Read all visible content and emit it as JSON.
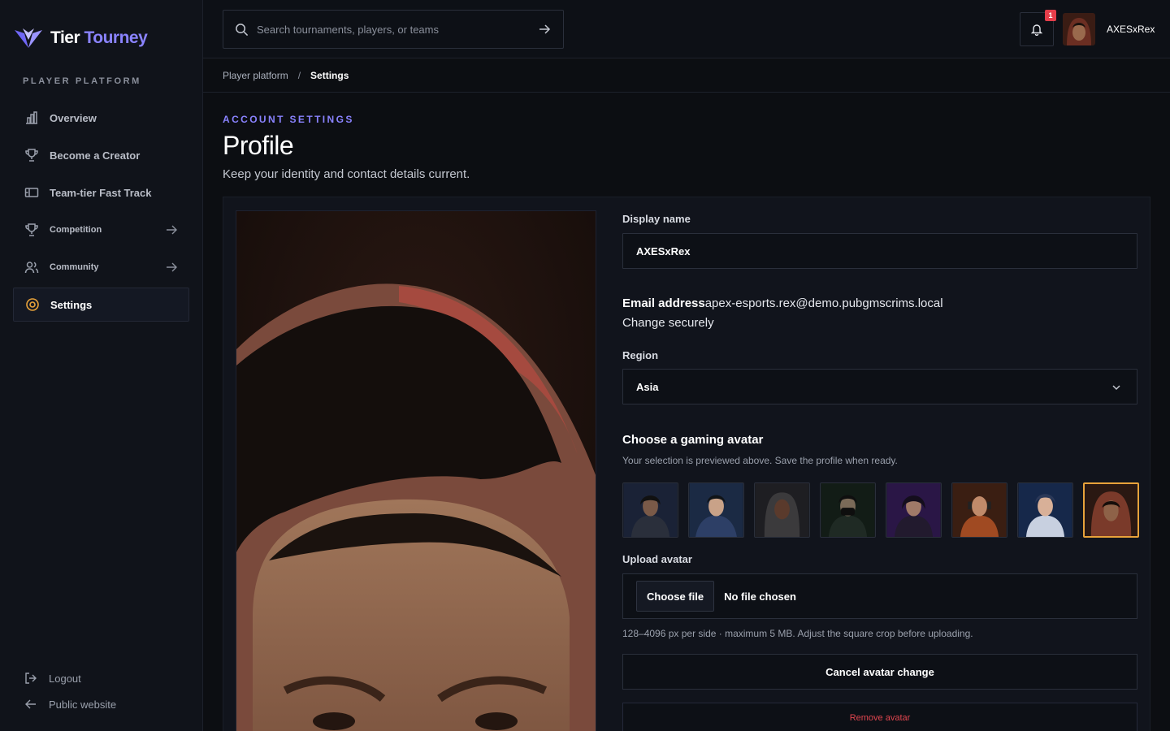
{
  "brand": {
    "name_part1": "Tier",
    "name_part2": "Tourney",
    "colors": {
      "accent": "#8a83ff",
      "danger": "#e0464f",
      "selected": "#e8a23a"
    }
  },
  "sidebar": {
    "section_label": "PLAYER PLATFORM",
    "items": [
      {
        "label": "Overview",
        "icon": "bar-chart-icon"
      },
      {
        "label": "Become a Creator",
        "icon": "trophy-icon"
      },
      {
        "label": "Team-tier Fast Track",
        "icon": "ticket-icon"
      },
      {
        "label": "Competition",
        "icon": "trophy-icon"
      },
      {
        "label": "Community",
        "icon": "users-icon"
      },
      {
        "label": "Settings",
        "icon": "settings-icon",
        "active": true
      }
    ],
    "bottom": [
      {
        "label": "Logout",
        "icon": "logout-icon"
      },
      {
        "label": "Public website",
        "icon": "arrow-left-icon"
      }
    ]
  },
  "topbar": {
    "search_placeholder": "Search tournaments, players, or teams",
    "notification_count": "1",
    "username": "AXESxRex"
  },
  "breadcrumb": {
    "parent": "Player platform",
    "separator": "/",
    "current": "Settings"
  },
  "header": {
    "eyebrow": "ACCOUNT SETTINGS",
    "title": "Profile",
    "subtitle": "Keep your identity and contact details current."
  },
  "form": {
    "display_name_label": "Display name",
    "display_name_value": "AXESxRex",
    "email_label": "Email address",
    "email_value": "apex-esports.rex@demo.pubgmscrims.local",
    "email_action": "Change securely",
    "region_label": "Region",
    "region_value": "Asia",
    "avatar_title": "Choose a gaming avatar",
    "avatar_help": "Your selection is previewed above. Save the profile when ready.",
    "upload_label": "Upload avatar",
    "choose_file": "Choose file",
    "no_file": "No file chosen",
    "upload_help": "128–4096 px per side · maximum 5 MB. Adjust the square crop before uploading.",
    "cancel_button": "Cancel avatar change",
    "remove_button": "Remove avatar"
  }
}
